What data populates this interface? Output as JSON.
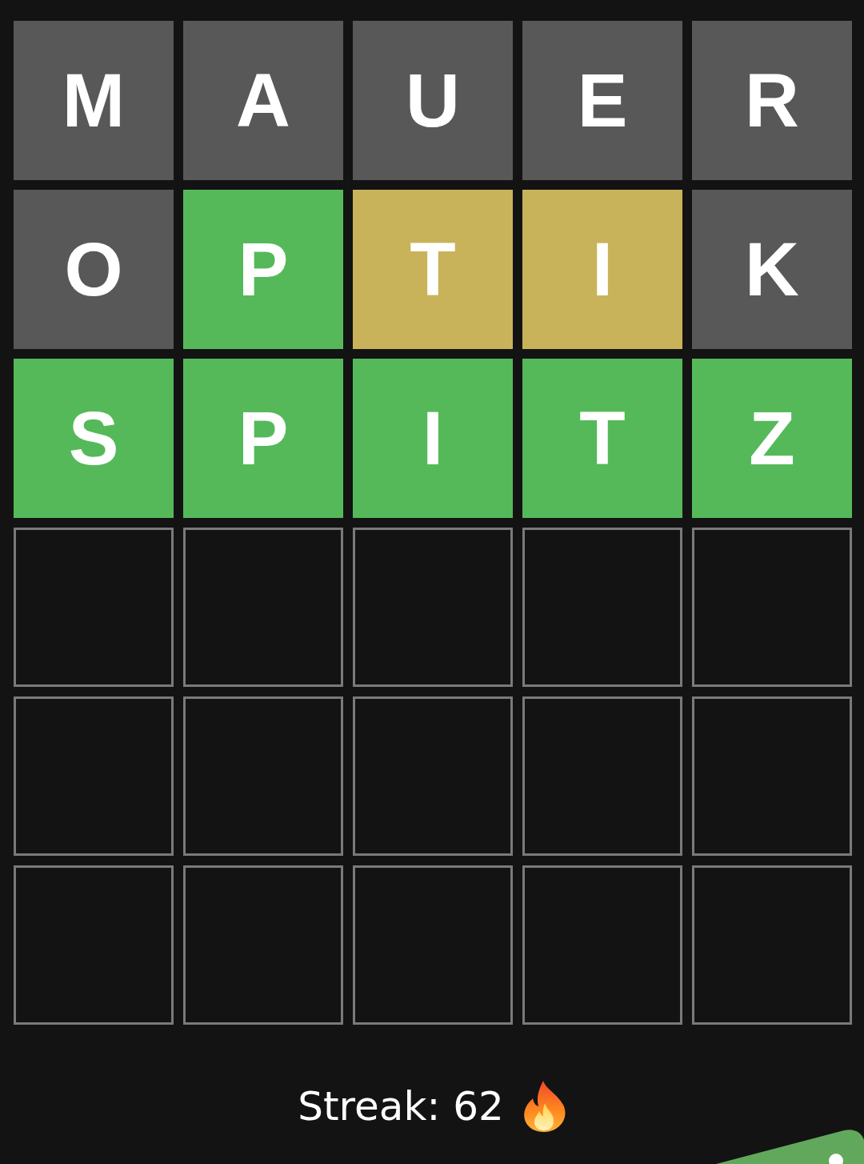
{
  "board": {
    "rows": [
      {
        "tiles": [
          {
            "letter": "M",
            "kind": "absent"
          },
          {
            "letter": "A",
            "kind": "absent"
          },
          {
            "letter": "U",
            "kind": "absent"
          },
          {
            "letter": "E",
            "kind": "absent"
          },
          {
            "letter": "R",
            "kind": "absent"
          }
        ]
      },
      {
        "tiles": [
          {
            "letter": "O",
            "kind": "absent"
          },
          {
            "letter": "P",
            "kind": "correct"
          },
          {
            "letter": "T",
            "kind": "present"
          },
          {
            "letter": "I",
            "kind": "present"
          },
          {
            "letter": "K",
            "kind": "absent"
          }
        ]
      },
      {
        "tiles": [
          {
            "letter": "S",
            "kind": "correct"
          },
          {
            "letter": "P",
            "kind": "correct"
          },
          {
            "letter": "I",
            "kind": "correct"
          },
          {
            "letter": "T",
            "kind": "correct"
          },
          {
            "letter": "Z",
            "kind": "correct"
          }
        ]
      },
      {
        "tiles": [
          {
            "kind": "empty"
          },
          {
            "kind": "empty"
          },
          {
            "kind": "empty"
          },
          {
            "kind": "empty"
          },
          {
            "kind": "empty"
          }
        ]
      },
      {
        "tiles": [
          {
            "kind": "empty"
          },
          {
            "kind": "empty"
          },
          {
            "kind": "empty"
          },
          {
            "kind": "empty"
          },
          {
            "kind": "empty"
          }
        ]
      },
      {
        "tiles": [
          {
            "kind": "empty"
          },
          {
            "kind": "empty"
          },
          {
            "kind": "empty"
          },
          {
            "kind": "empty"
          },
          {
            "kind": "empty"
          }
        ]
      }
    ]
  },
  "streak": {
    "label": "Streak: 62"
  }
}
